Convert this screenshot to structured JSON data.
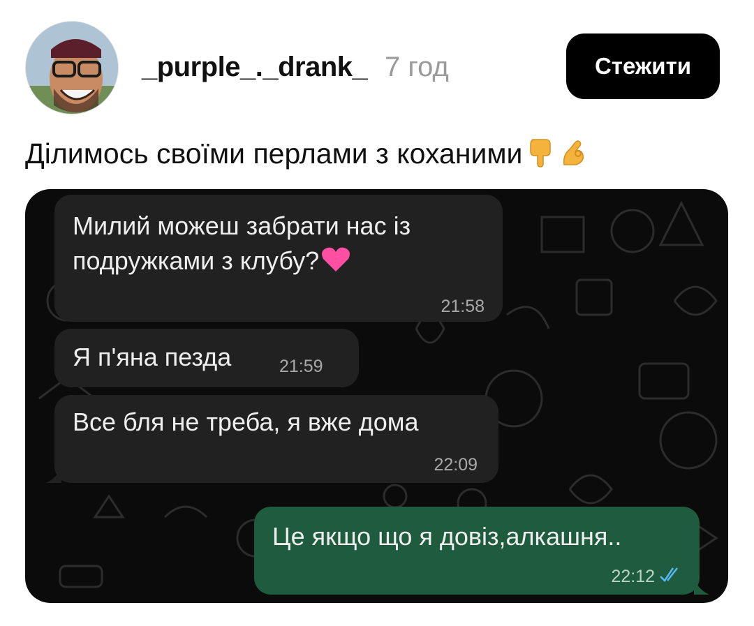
{
  "post": {
    "username": "_purple_._drank_",
    "time_ago": "7 год",
    "follow_label": "Стежити",
    "caption": "Ділимось своїми перлами з коханими"
  },
  "chat": {
    "messages": [
      {
        "direction": "incoming",
        "line1": "Милий можеш забрати нас із",
        "line2": "подружками з клубу?",
        "time": "21:58"
      },
      {
        "direction": "incoming",
        "line1": "Я п'яна пезда",
        "time": "21:59"
      },
      {
        "direction": "incoming",
        "line1": "Все бля не треба, я вже дома",
        "time": "22:09"
      },
      {
        "direction": "outgoing",
        "line1": "Це якщо що я довіз,алкашня..",
        "time": "22:12",
        "status": "read-double-check-icon"
      }
    ]
  },
  "colors": {
    "follow_bg": "#000000",
    "chat_bg": "#0b0b0b",
    "incoming_bubble": "#212121",
    "outgoing_bubble": "#1f5b3f",
    "read_check": "#58b7f0"
  }
}
